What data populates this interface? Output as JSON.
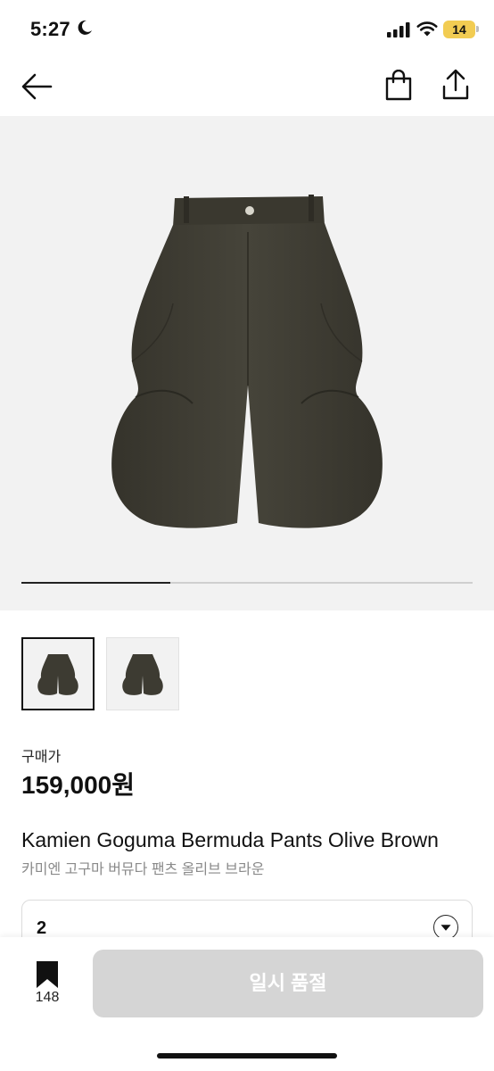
{
  "status_bar": {
    "time": "5:27",
    "battery": "14",
    "icons": [
      "moon-icon",
      "signal-icon",
      "wifi-icon",
      "battery-icon"
    ]
  },
  "top_nav": {
    "icons": [
      "back-arrow-icon",
      "shopping-bag-icon",
      "share-icon"
    ]
  },
  "gallery": {
    "progress": 0.33,
    "thumbnail_count": 2,
    "selected_index": 0
  },
  "product": {
    "price_label": "구매가",
    "price": "159,000원",
    "name": "Kamien Goguma Bermuda Pants Olive Brown",
    "name_ko": "카미엔 고구마 버뮤다 팬츠 올리브 브라운"
  },
  "option": {
    "value": "2",
    "icon": "chevron-down-icon"
  },
  "bottom_bar": {
    "bookmark_count": "148",
    "button_label": "일시 품절"
  },
  "colors": {
    "product": "#3d3b32",
    "image_bg": "#f2f2f2",
    "button_disabled": "#d5d5d5",
    "battery": "#f2cc52"
  }
}
